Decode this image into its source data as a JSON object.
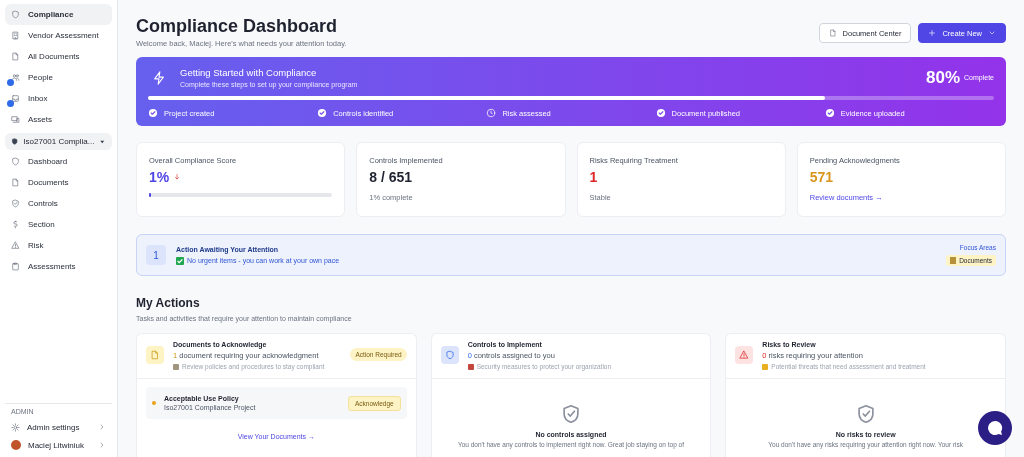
{
  "sidebar": {
    "items": [
      {
        "label": "Compliance",
        "selected": true,
        "badge": false
      },
      {
        "label": "Vendor Assessment",
        "selected": false,
        "badge": false
      },
      {
        "label": "All Documents",
        "selected": false,
        "badge": false
      },
      {
        "label": "People",
        "selected": false,
        "badge": true
      },
      {
        "label": "Inbox",
        "selected": false,
        "badge": true
      },
      {
        "label": "Assets",
        "selected": false,
        "badge": false
      }
    ],
    "project": {
      "label": "Iso27001 Complia..."
    },
    "project_items": [
      {
        "label": "Dashboard",
        "selected": false
      },
      {
        "label": "Documents",
        "selected": false
      },
      {
        "label": "Controls",
        "selected": false
      },
      {
        "label": "Section",
        "selected": false
      },
      {
        "label": "Risk",
        "selected": false
      },
      {
        "label": "Assessments",
        "selected": false
      }
    ],
    "admin_heading": "ADMIN",
    "admin_items": [
      {
        "label": "Admin settings"
      },
      {
        "label": "Maciej Litwiniuk"
      }
    ]
  },
  "header": {
    "title": "Compliance Dashboard",
    "subtitle": "Welcome back, Maciej. Here's what needs your attention today.",
    "buttons": [
      {
        "label": "Document Center",
        "kind": "secondary"
      },
      {
        "label": "Create New",
        "kind": "primary"
      }
    ]
  },
  "getting_started": {
    "title": "Getting Started with Compliance",
    "subtitle": "Complete these steps to set up your compliance program",
    "percent": "80%",
    "percent_label": "Complete",
    "level": 0.8,
    "steps": [
      {
        "label": "Project created",
        "done": true
      },
      {
        "label": "Controls identified",
        "done": true
      },
      {
        "label": "Risk assessed",
        "done": false
      },
      {
        "label": "Document published",
        "done": true
      },
      {
        "label": "Evidence uploaded",
        "done": true
      }
    ]
  },
  "stats": [
    {
      "label": "Overall Compliance Score",
      "value": "1%",
      "kind": "bar",
      "color": "#4f46e5",
      "level": 0.01
    },
    {
      "label": "Controls Implemented",
      "value": "8 / 651",
      "kind": "note",
      "color": "#1f2330",
      "note": "1% complete"
    },
    {
      "label": "Risks Requiring Treatment",
      "value": "1",
      "kind": "note",
      "color": "#dc2626",
      "note": "Stable"
    },
    {
      "label": "Pending Acknowledgments",
      "value": "571",
      "kind": "link",
      "color": "#d9961a",
      "link": "Review documents →"
    }
  ],
  "attention": {
    "count": "1",
    "title": "Action Awaiting Your Attention",
    "message": "No urgent items - you can work at your own pace",
    "focus_label": "Focus Areas",
    "focus_tag": "Documents"
  },
  "my_actions": {
    "title": "My Actions",
    "subtitle": "Tasks and activities that require your attention to maintain compliance",
    "cards": [
      {
        "kind": "documents",
        "title": "Documents to Acknowledge",
        "count": "1",
        "summary": "document requiring your acknowledgment",
        "hint": "Review policies and procedures to stay compliant",
        "badge": "Action Required",
        "items": [
          {
            "title": "Acceptable Use Policy",
            "subtitle": "Iso27001 Compliance Project",
            "action": "Acknowledge"
          }
        ],
        "link": "View Your Documents →"
      },
      {
        "kind": "controls",
        "title": "Controls to Implement",
        "count": "0",
        "summary": "controls assigned to you",
        "hint": "Security measures to protect your organization",
        "empty_title": "No controls assigned",
        "empty_text": "You don't have any controls to implement right now. Great job staying on top of"
      },
      {
        "kind": "risks",
        "title": "Risks to Review",
        "count": "0",
        "summary": "risks requiring your attention",
        "hint": "Potential threats that need assessment and treatment",
        "empty_title": "No risks to review",
        "empty_text": "You don't have any risks requiring your attention right now. Your risk"
      }
    ]
  }
}
